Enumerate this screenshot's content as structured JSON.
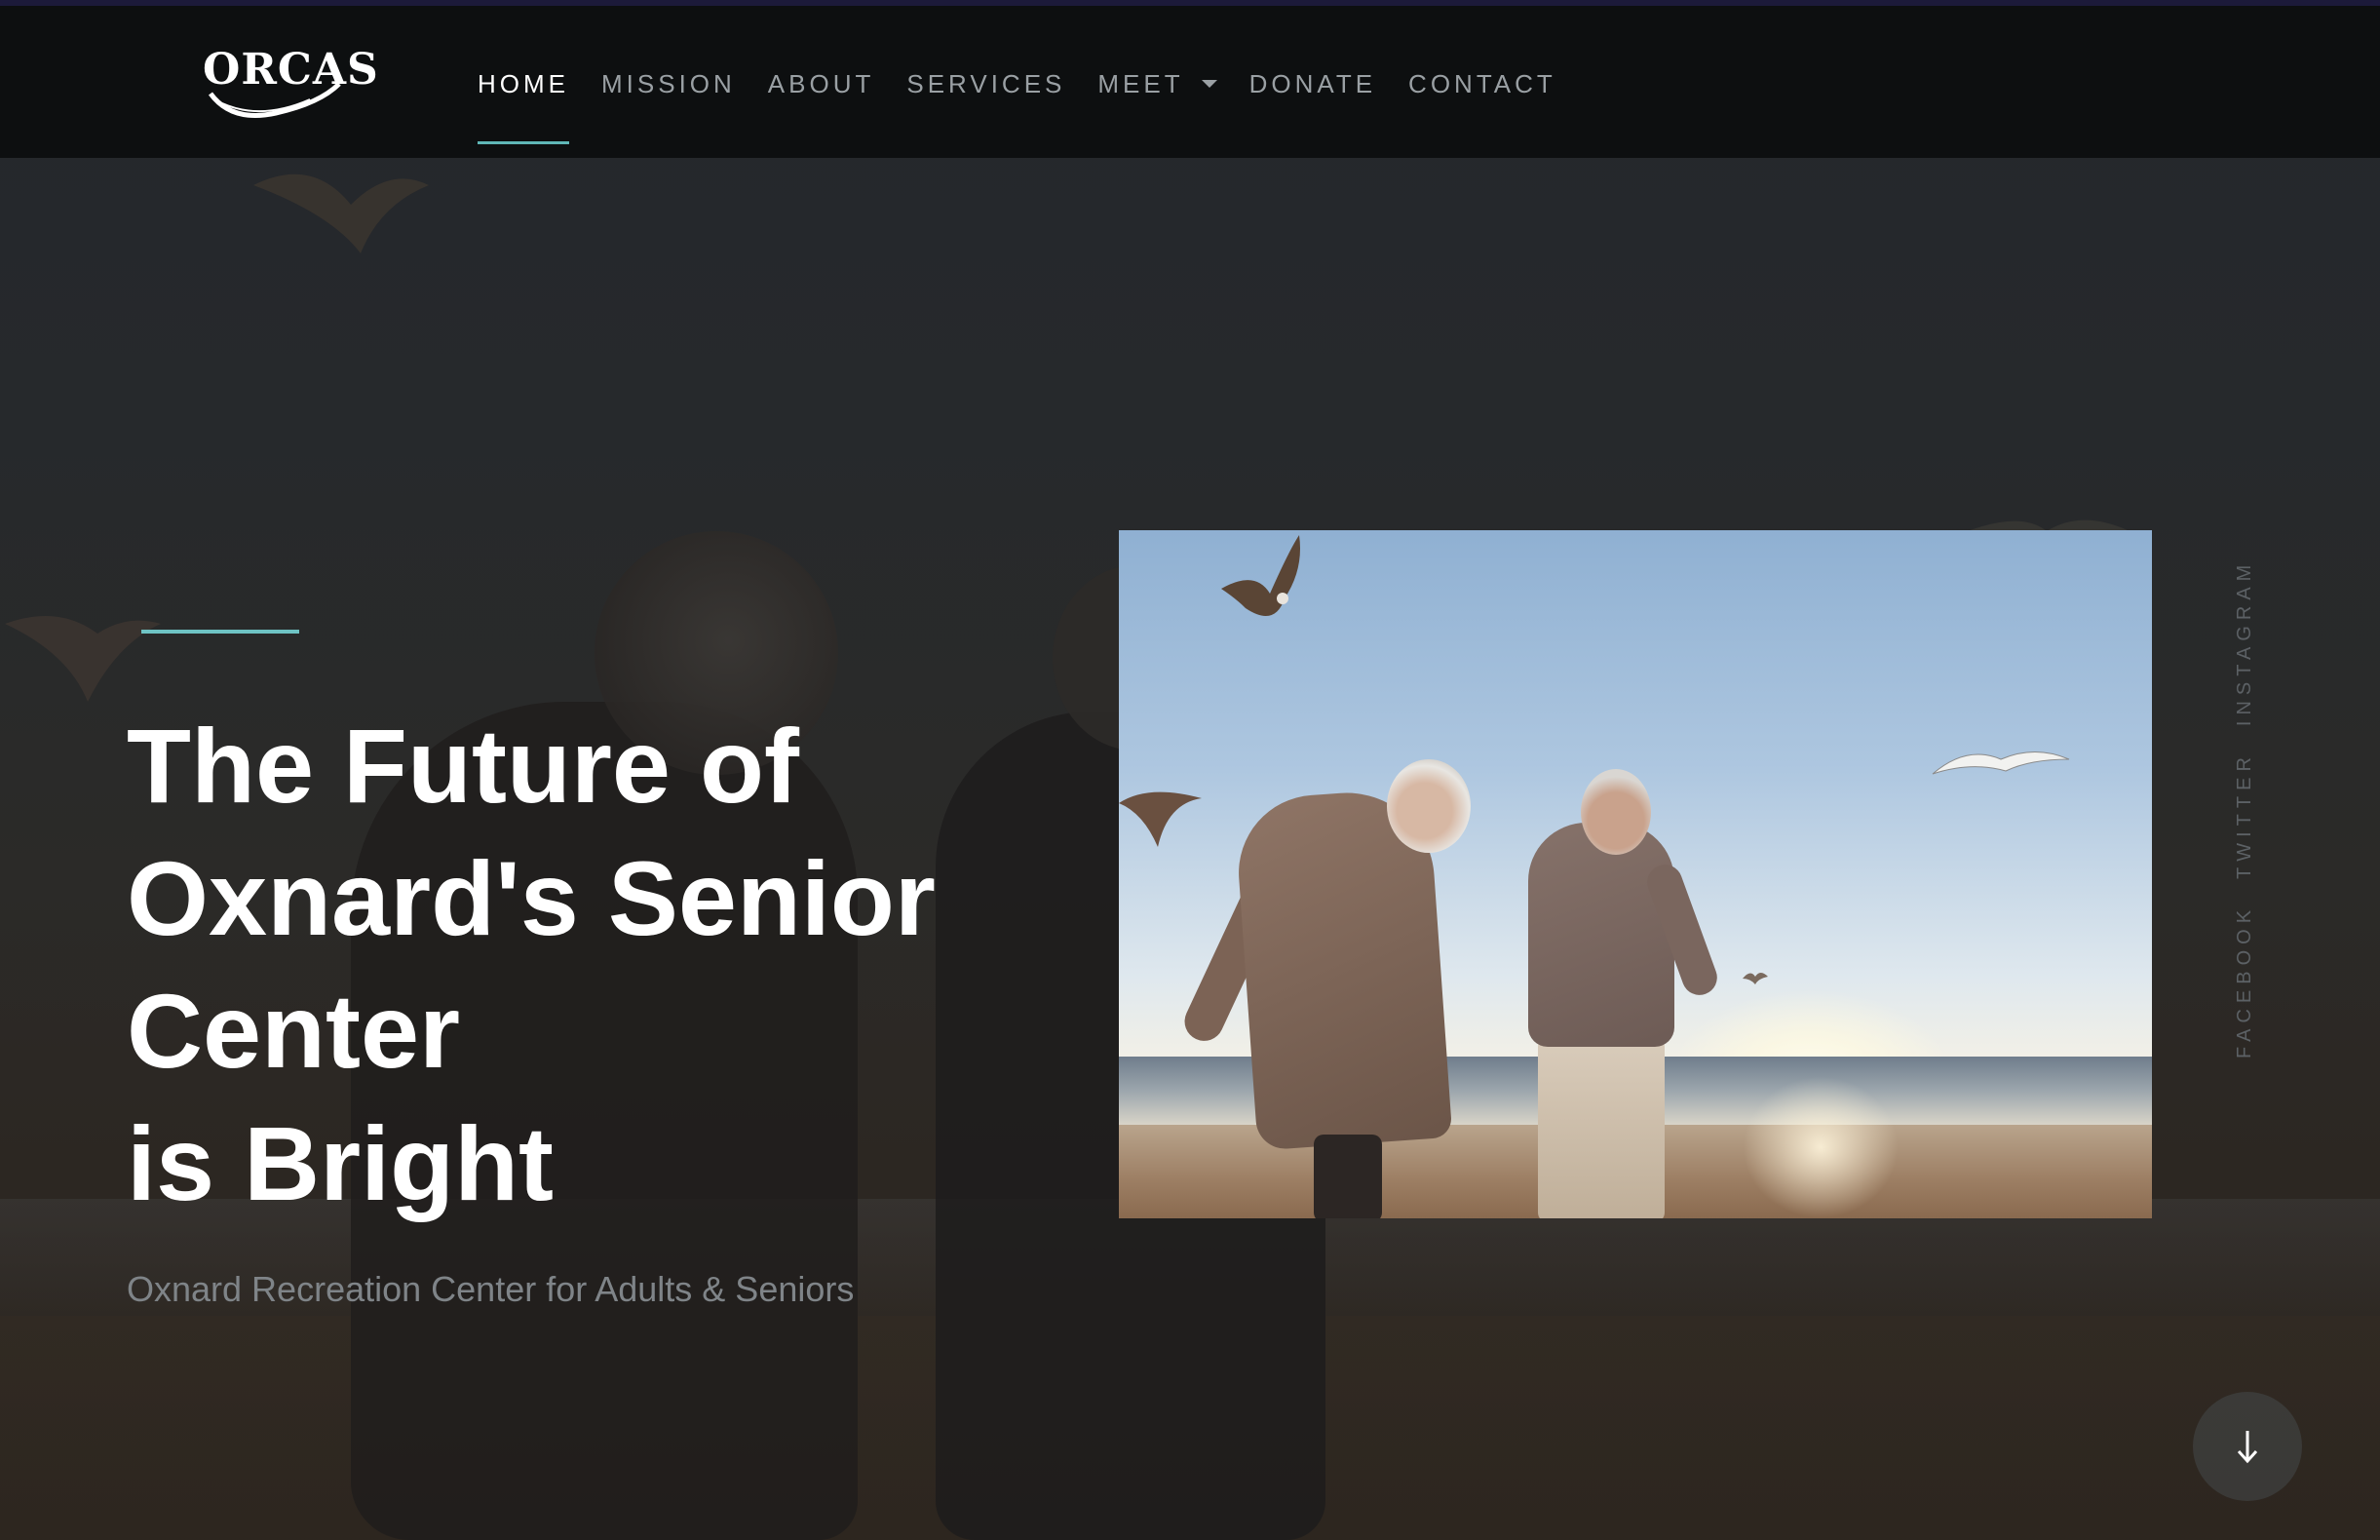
{
  "header": {
    "logo_text": "ORCAS",
    "nav": [
      {
        "label": "HOME",
        "active": true
      },
      {
        "label": "MISSION"
      },
      {
        "label": "ABOUT"
      },
      {
        "label": "SERVICES"
      },
      {
        "label": "MEET",
        "dropdown": true
      },
      {
        "label": "DONATE"
      },
      {
        "label": "CONTACT"
      }
    ]
  },
  "hero": {
    "title_lines": [
      "The Future of",
      "Oxnard's Senior",
      "Center",
      "is Bright"
    ],
    "subtitle": "Oxnard Recreation Center for Adults & Seniors"
  },
  "social": [
    "FACEBOOK",
    "TWITTER",
    "INSTAGRAM"
  ],
  "icons": {
    "scroll": "arrow-down-icon",
    "dropdown": "caret-down-icon"
  },
  "colors": {
    "accent": "#6ec3c4",
    "header_bg": "#0d0f10",
    "nav_text": "#9aa0a4",
    "subtitle_text": "#7f8488"
  }
}
